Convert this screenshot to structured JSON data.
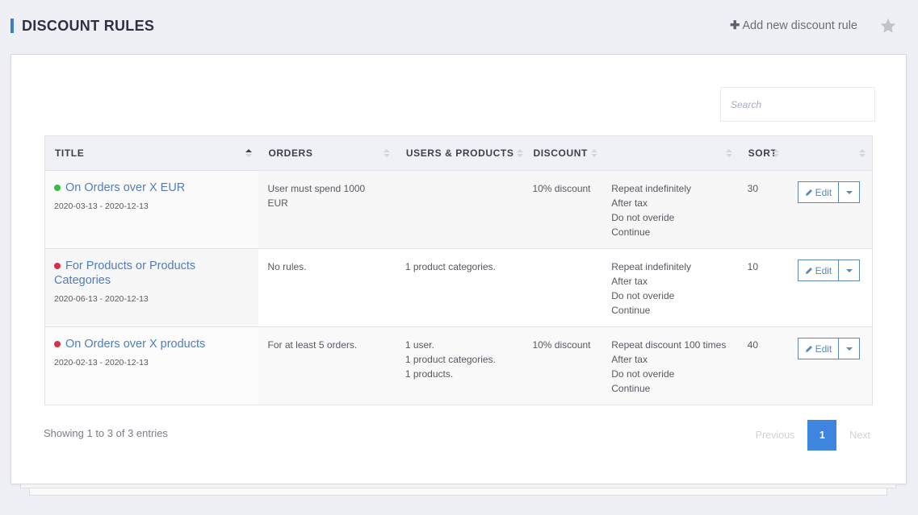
{
  "header": {
    "title": "DISCOUNT RULES",
    "add_label": "Add new discount rule",
    "add_icon": "plus-icon",
    "favorite_icon": "star-icon"
  },
  "search": {
    "placeholder": "Search",
    "value": ""
  },
  "table": {
    "columns": [
      {
        "label": "TITLE",
        "sort": "ascending"
      },
      {
        "label": "ORDERS",
        "sort": "none"
      },
      {
        "label": "USERS & PRODUCTS",
        "sort": "none"
      },
      {
        "label": "DISCOUNT",
        "sort": "none"
      },
      {
        "label": "",
        "sort": "none"
      },
      {
        "label": "SORT",
        "sort": "none"
      },
      {
        "label": "",
        "sort": "none"
      }
    ],
    "rows": [
      {
        "status": "active",
        "status_color": "#34bf3d",
        "title": "On Orders over X EUR",
        "dates": "2020-03-13 - 2020-12-13",
        "orders": [
          "User must spend 1000 EUR"
        ],
        "users_products": [],
        "discount": "10% discount",
        "settings": [
          "Repeat indefinitely",
          "After tax",
          "Do not overide",
          "Continue"
        ],
        "sort": "30",
        "edit_label": "Edit"
      },
      {
        "status": "inactive",
        "status_color": "#d9304a",
        "title": "For Products or Products Categories",
        "dates": "2020-06-13 - 2020-12-13",
        "orders": [
          "No rules."
        ],
        "users_products": [
          "1 product categories."
        ],
        "discount": "",
        "settings": [
          "Repeat indefinitely",
          "After tax",
          "Do not overide",
          "Continue"
        ],
        "sort": "10",
        "edit_label": "Edit"
      },
      {
        "status": "inactive",
        "status_color": "#d9304a",
        "title": "On Orders over X products",
        "dates": "2020-02-13 - 2020-12-13",
        "orders": [
          "For at least 5 orders."
        ],
        "users_products": [
          "1 user.",
          "1 product categories.",
          "1 products."
        ],
        "discount": "10% discount",
        "settings": [
          "Repeat discount 100 times",
          "After tax",
          "Do not overide",
          "Continue"
        ],
        "sort": "40",
        "edit_label": "Edit"
      }
    ]
  },
  "footer": {
    "info": "Showing 1 to 3 of 3 entries",
    "previous": "Previous",
    "current_page": "1",
    "next": "Next"
  },
  "colors": {
    "accent": "#3f7ec2",
    "link": "#4f7cbf",
    "pager_active": "#3d85df"
  }
}
